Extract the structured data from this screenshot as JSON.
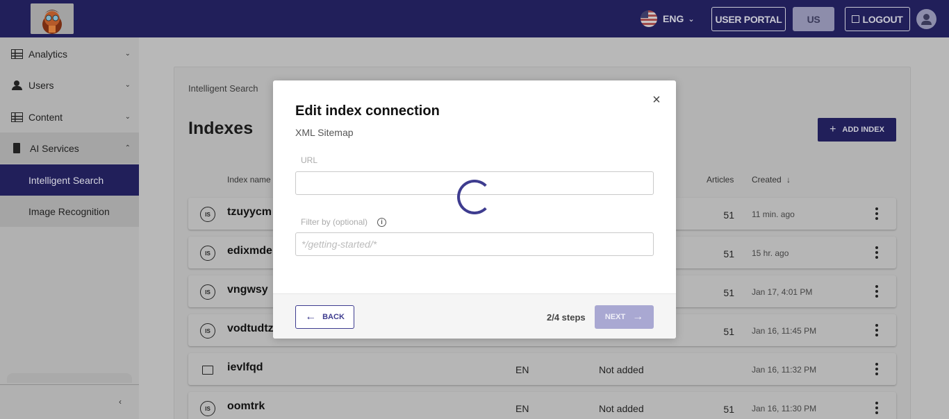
{
  "header": {
    "language": "ENG",
    "user_portal": "USER PORTAL",
    "region": "US",
    "logout": "LOGOUT"
  },
  "sidebar": {
    "items": [
      {
        "label": "Analytics",
        "icon": "table-icon"
      },
      {
        "label": "Users",
        "icon": "users-icon"
      },
      {
        "label": "Content",
        "icon": "table-icon"
      },
      {
        "label": "AI Services",
        "icon": "chip-icon"
      }
    ],
    "sub_items": [
      {
        "label": "Intelligent Search",
        "active": true
      },
      {
        "label": "Image Recognition",
        "active": false
      }
    ]
  },
  "main": {
    "breadcrumb": "Intelligent Search",
    "title": "Indexes",
    "add_button": "ADD INDEX",
    "columns": {
      "name": "Index name",
      "articles": "Articles",
      "created": "Created"
    },
    "rows": [
      {
        "icon_text": "IS",
        "name": "tzuyycm",
        "lang": "",
        "status": "",
        "articles": "51",
        "created": "11 min. ago"
      },
      {
        "icon_text": "IS",
        "name": "edixmde",
        "lang": "",
        "status": "",
        "articles": "51",
        "created": "15 hr. ago"
      },
      {
        "icon_text": "IS",
        "name": "vngwsy",
        "lang": "",
        "status": "",
        "articles": "51",
        "created": "Jan 17, 4:01 PM"
      },
      {
        "icon_text": "IS",
        "name": "vodtudtz",
        "lang": "",
        "status": "",
        "articles": "51",
        "created": "Jan 16, 11:45 PM"
      },
      {
        "icon_text": "",
        "name": "ievlfqd",
        "lang": "EN",
        "status": "Not added",
        "articles": "",
        "created": "Jan 16, 11:32 PM"
      },
      {
        "icon_text": "IS",
        "name": "oomtrk",
        "lang": "EN",
        "status": "Not added",
        "articles": "51",
        "created": "Jan 16, 11:30 PM"
      }
    ]
  },
  "modal": {
    "title": "Edit index connection",
    "subtitle": "XML Sitemap",
    "url_label": "URL",
    "url_value": "",
    "filter_label": "Filter by (optional)",
    "filter_placeholder": "*/getting-started/*",
    "back": "BACK",
    "steps": "2/4 steps",
    "next": "NEXT"
  },
  "colors": {
    "primary": "#211f5a",
    "accent": "#3e3c8f",
    "next_disabled": "#a9a8d2"
  }
}
